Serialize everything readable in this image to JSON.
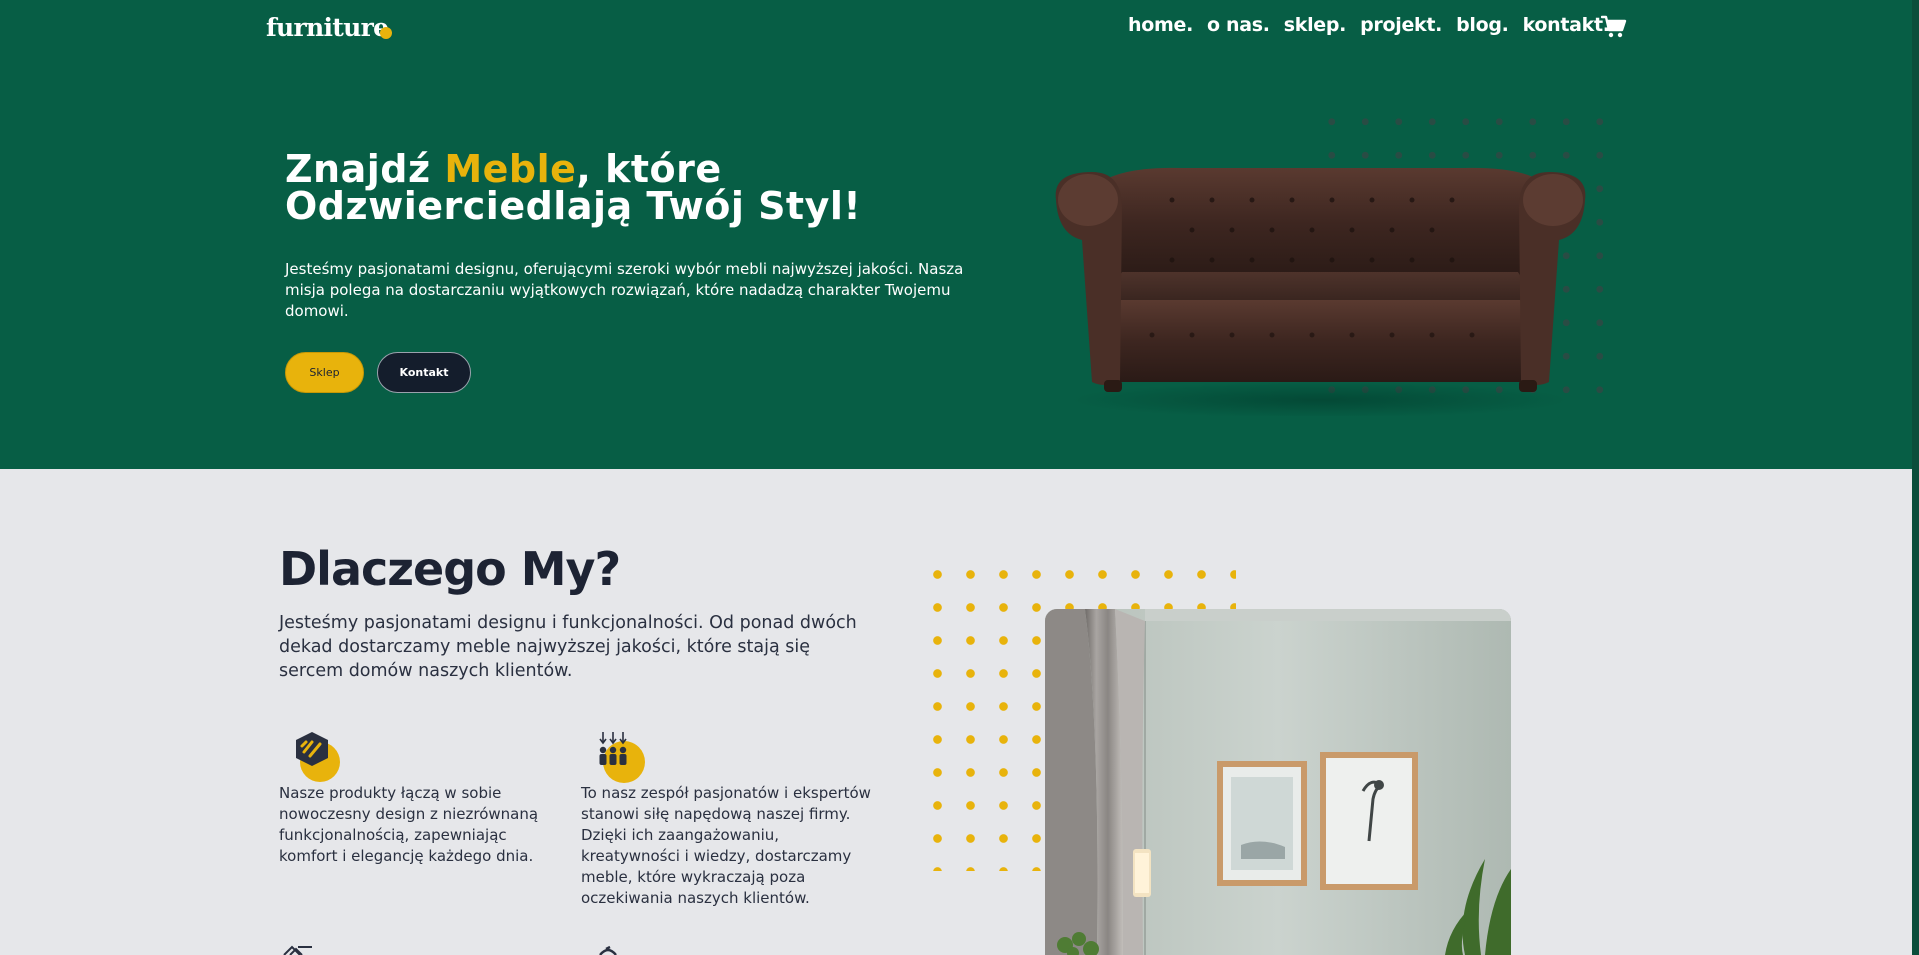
{
  "nav": {
    "logo": "furniture",
    "links": [
      "home.",
      "o nas.",
      "sklep.",
      "projekt.",
      "blog.",
      "kontakt."
    ],
    "cart_icon": "cart-icon"
  },
  "hero": {
    "title_part1": "Znajdź ",
    "title_accent": "Meble",
    "title_part2": ", które Odzwierciedlają Twój Styl!",
    "description": "Jesteśmy pasjonatami designu, oferującymi szeroki wybór mebli najwyższej jakości. Nasza misja polega na dostarczaniu wyjątkowych rozwiązań, które nadadzą charakter Twojemu domowi.",
    "button_shop": "Sklep",
    "button_contact": "Kontakt"
  },
  "why": {
    "title": "Dlaczego My?",
    "description": "Jesteśmy pasjonatami designu i funkcjonalności. Od ponad dwóch dekad dostarczamy meble najwyższej jakości, które stają się sercem domów naszych klientów.",
    "features": [
      {
        "icon": "design-hexagon-icon",
        "text": "Nasze produkty łączą w sobie nowoczesny design z niezrównaną funkcjonalnością, zapewniając komfort i elegancję każdego dnia."
      },
      {
        "icon": "team-people-icon",
        "text": "To nasz zespół pasjonatów i ekspertów stanowi siłę napędową naszej firmy. Dzięki ich zaangażowaniu, kreatywności i wiedzy, dostarczamy meble, które wykraczają poza oczekiwania naszych klientów."
      }
    ]
  },
  "colors": {
    "hero_bg": "#075e45",
    "accent": "#e8b30c",
    "dark": "#141d2c",
    "section_bg": "#e6e7ea"
  }
}
